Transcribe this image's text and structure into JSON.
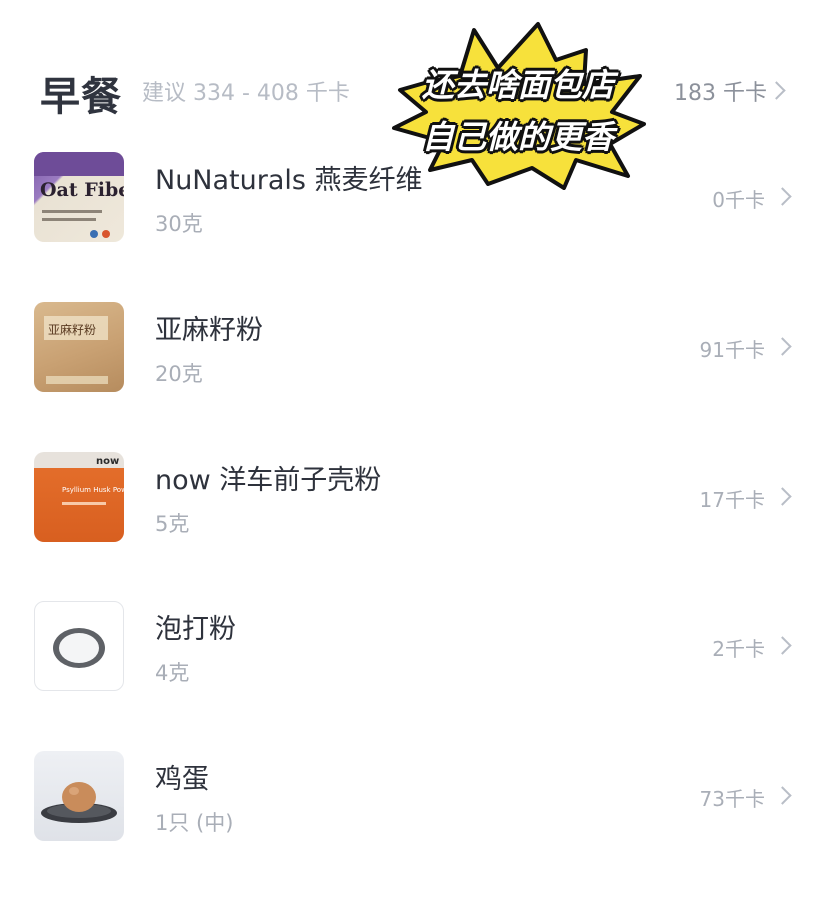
{
  "meal": {
    "title": "早餐",
    "suggestion": "建议 334 - 408 千卡",
    "total": "183 千卡"
  },
  "sticker": {
    "line1": "还去啥面包店",
    "line2": "自己做的更香"
  },
  "items": [
    {
      "name": "NuNaturals 燕麦纤维",
      "qty": "30克",
      "kcal": "0千卡",
      "thumb_icon": "oat-fiber-package-photo",
      "thumb_text": "Oat Fiber"
    },
    {
      "name": "亚麻籽粉",
      "qty": "20克",
      "kcal": "91千卡",
      "thumb_icon": "flaxseed-powder-bag-photo",
      "thumb_text": "亚麻籽粉"
    },
    {
      "name": "now 洋车前子壳粉",
      "qty": "5克",
      "kcal": "17千卡",
      "thumb_icon": "psyllium-husk-bag-photo",
      "thumb_text": "Psyllium Husk Powder"
    },
    {
      "name": "泡打粉",
      "qty": "4克",
      "kcal": "2千卡",
      "thumb_icon": "baking-powder-bowl-icon"
    },
    {
      "name": "鸡蛋",
      "qty": "1只 (中)",
      "kcal": "73千卡",
      "thumb_icon": "egg-on-plate-photo"
    }
  ],
  "colors": {
    "title": "#30343f",
    "muted": "#a9aeb7",
    "sticker_fill": "#f7e13b",
    "sticker_outline": "#111111"
  }
}
